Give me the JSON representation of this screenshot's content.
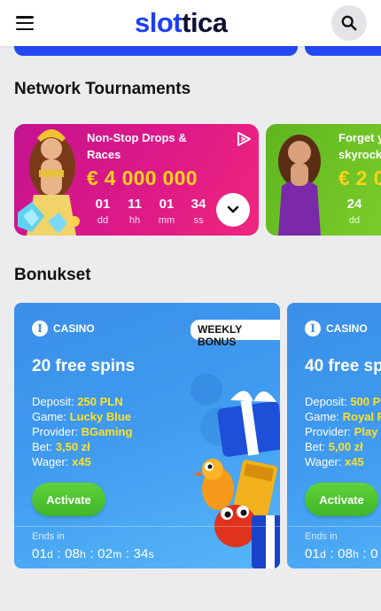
{
  "header": {
    "logo_part1": "slot",
    "logo_part2": "tica"
  },
  "tournaments": {
    "title": "Network Tournaments",
    "cards": [
      {
        "name_line1": "Non-Stop Drops &",
        "name_line2": "Races",
        "prize": "€ 4 000 000",
        "countdown": [
          {
            "value": "01",
            "unit": "dd"
          },
          {
            "value": "11",
            "unit": "hh"
          },
          {
            "value": "01",
            "unit": "mm"
          },
          {
            "value": "34",
            "unit": "ss"
          }
        ]
      },
      {
        "name_line1": "Forget y",
        "name_line2": "skyrock",
        "prize": "€ 2 0",
        "countdown": [
          {
            "value": "24",
            "unit": "dd"
          }
        ]
      }
    ]
  },
  "bonuses": {
    "title": "Bonukset",
    "cards": [
      {
        "category": "CASINO",
        "tag": "WEEKLY BONUS",
        "title": "20 free spins",
        "deposit_label": "Deposit:",
        "deposit_value": "250 PLN",
        "game_label": "Game:",
        "game_value": "Lucky Blue",
        "provider_label": "Provider:",
        "provider_value": "BGaming",
        "bet_label": "Bet:",
        "bet_value": "3,50 zł",
        "wager_label": "Wager:",
        "wager_value": "x45",
        "activate_label": "Activate",
        "ends_in_label": "Ends in",
        "ends_d": "01",
        "ends_h": "08",
        "ends_m": "02",
        "ends_s": "34"
      },
      {
        "category": "CASINO",
        "title": "40 free sp",
        "deposit_label": "Deposit:",
        "deposit_value": "500 P",
        "game_label": "Game:",
        "game_value": "Royal R",
        "provider_label": "Provider:",
        "provider_value": "Play",
        "bet_label": "Bet:",
        "bet_value": "5,00 zł",
        "wager_label": "Wager:",
        "wager_value": "x45",
        "activate_label": "Activate",
        "ends_in_label": "Ends in",
        "ends_d": "01",
        "ends_h": "08",
        "ends_m": "0"
      }
    ]
  },
  "units": {
    "d": "d",
    "h": "h",
    "m": "m",
    "s": "s"
  },
  "icons": {
    "menu": "hamburger-menu-icon",
    "search": "search-icon",
    "play": "play-triangle-icon",
    "chevron": "chevron-down-icon",
    "info": "info-icon"
  },
  "colors": {
    "brand_blue": "#1d3ff2",
    "brand_dark": "#0d1030",
    "tournament_pink": "#e01a86",
    "tournament_green": "#7ccf2a",
    "prize_yellow": "#ffd21a",
    "bonus_blue": "#3f9af0",
    "activate_green": "#4cc432"
  }
}
